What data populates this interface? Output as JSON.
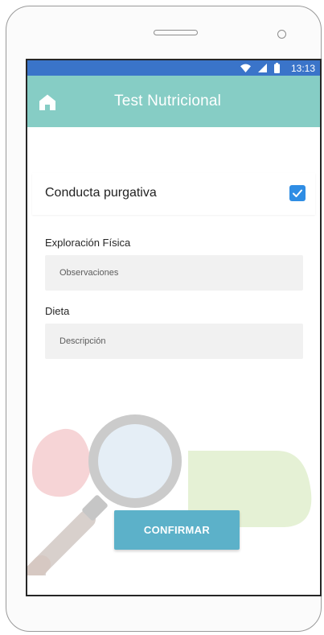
{
  "status_bar": {
    "time": "13:13",
    "icons": [
      "wifi-icon",
      "signal-icon",
      "battery-icon"
    ],
    "color": "#3a74c9"
  },
  "app_bar": {
    "title": "Test Nutricional",
    "icon": "home-icon",
    "color": "#86cdc5"
  },
  "checkbox_row": {
    "label": "Conducta purgativa",
    "checked": true,
    "accent": "#2f8de4"
  },
  "form": {
    "exploracion": {
      "label": "Exploración Física",
      "placeholder": "Observaciones",
      "value": ""
    },
    "dieta": {
      "label": "Dieta",
      "placeholder": "Descripción",
      "value": ""
    }
  },
  "confirm_button": {
    "label": "CONFIRMAR",
    "color": "#5cb1c9"
  },
  "background_illustration": "magnifier-illustration"
}
